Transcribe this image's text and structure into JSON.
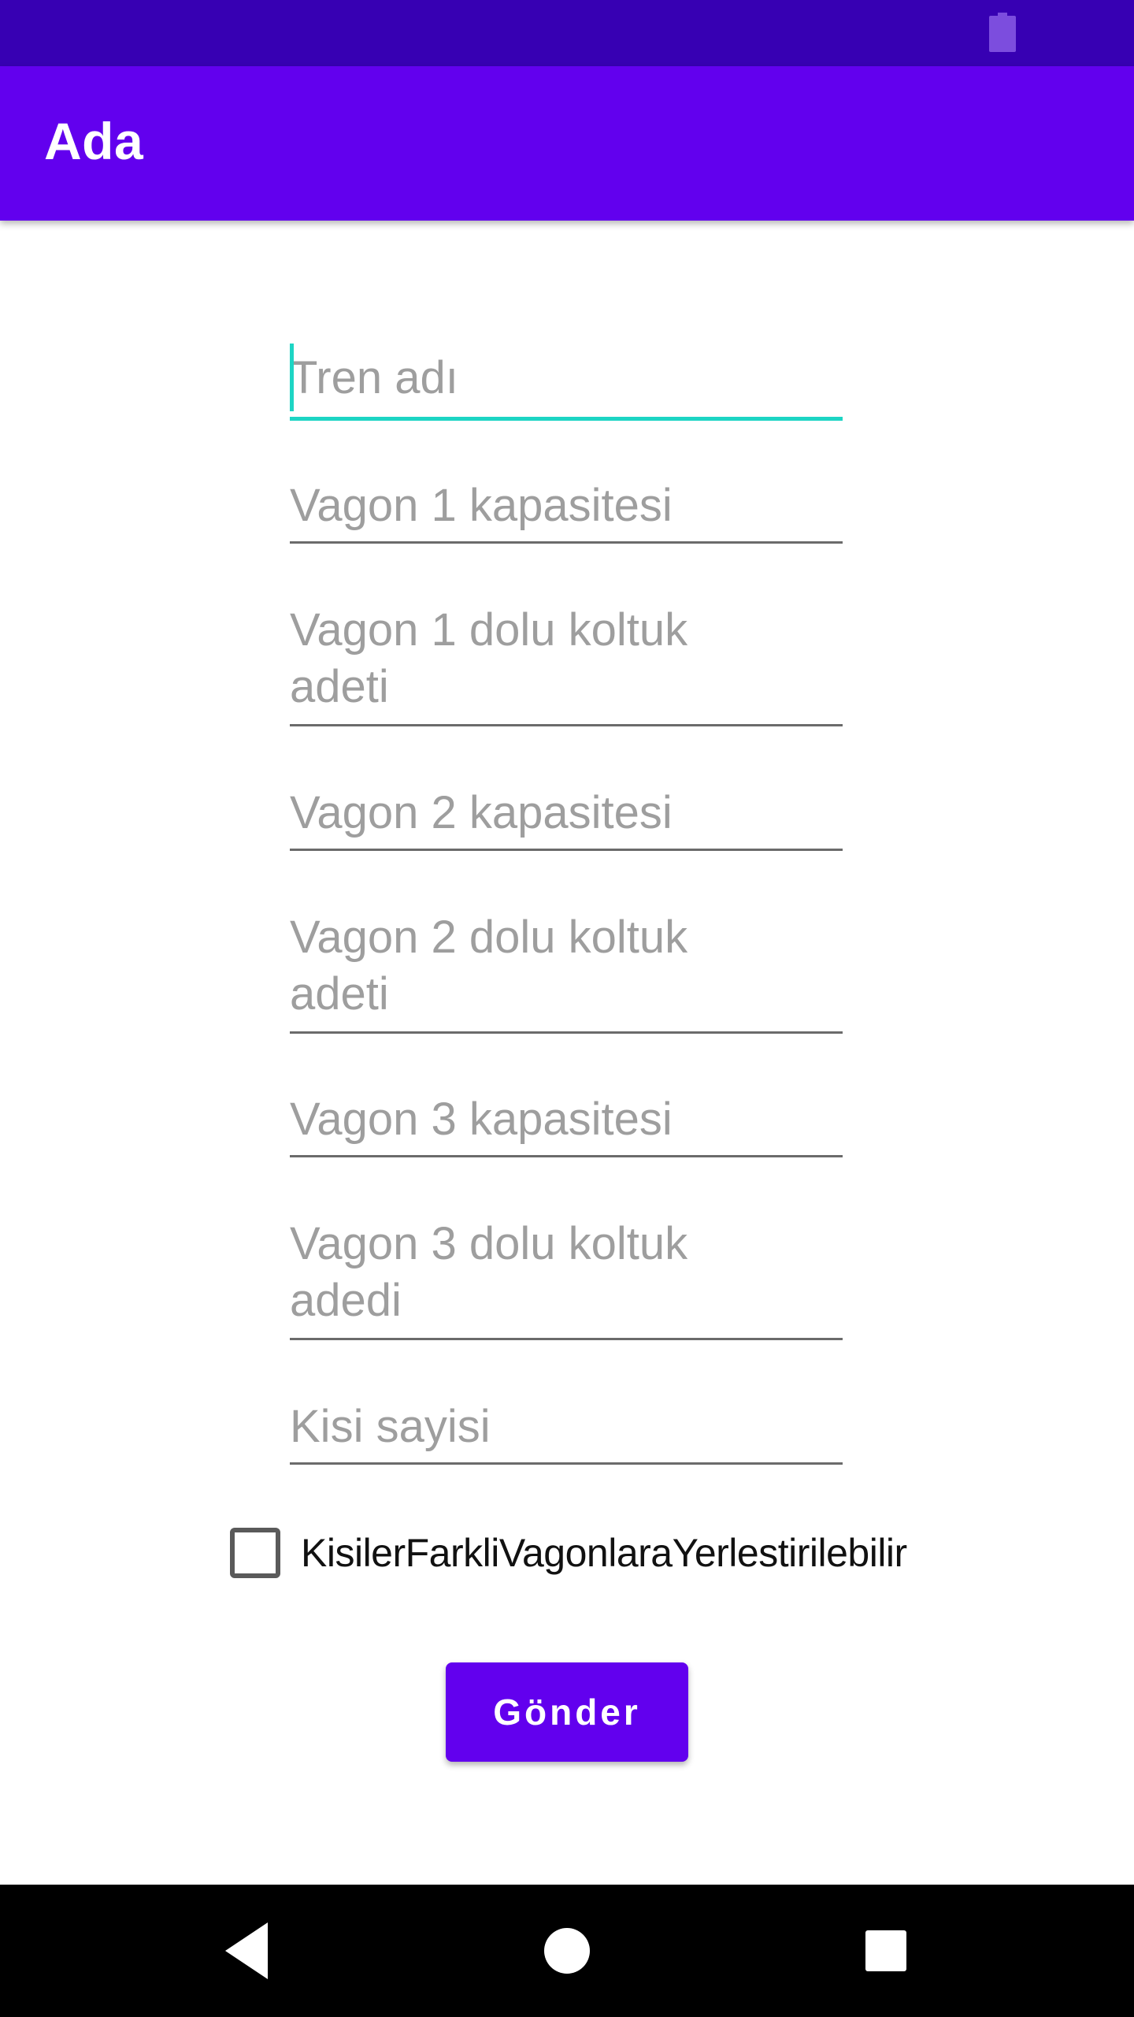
{
  "app": {
    "title": "Ada"
  },
  "colors": {
    "primary": "#6200ee",
    "primary_dark": "#3700b3",
    "accent": "#1dd5c4"
  },
  "form": {
    "fields": [
      {
        "placeholder": "Tren adı",
        "focused": true
      },
      {
        "placeholder": "Vagon 1 kapasitesi",
        "focused": false
      },
      {
        "placeholder": "Vagon 1 dolu koltuk adeti",
        "focused": false
      },
      {
        "placeholder": "Vagon 2 kapasitesi",
        "focused": false
      },
      {
        "placeholder": "Vagon 2 dolu koltuk adeti",
        "focused": false
      },
      {
        "placeholder": "Vagon 3 kapasitesi",
        "focused": false
      },
      {
        "placeholder": "Vagon 3 dolu koltuk adedi",
        "focused": false
      },
      {
        "placeholder": "Kisi sayisi",
        "focused": false
      }
    ],
    "checkbox": {
      "label": "KisilerFarkliVagonlaraYerlestirilebilir",
      "checked": false
    },
    "submit_label": "Gönder"
  },
  "icons": {
    "status": "battery-icon",
    "nav": [
      "back-icon",
      "home-icon",
      "recents-icon"
    ]
  }
}
